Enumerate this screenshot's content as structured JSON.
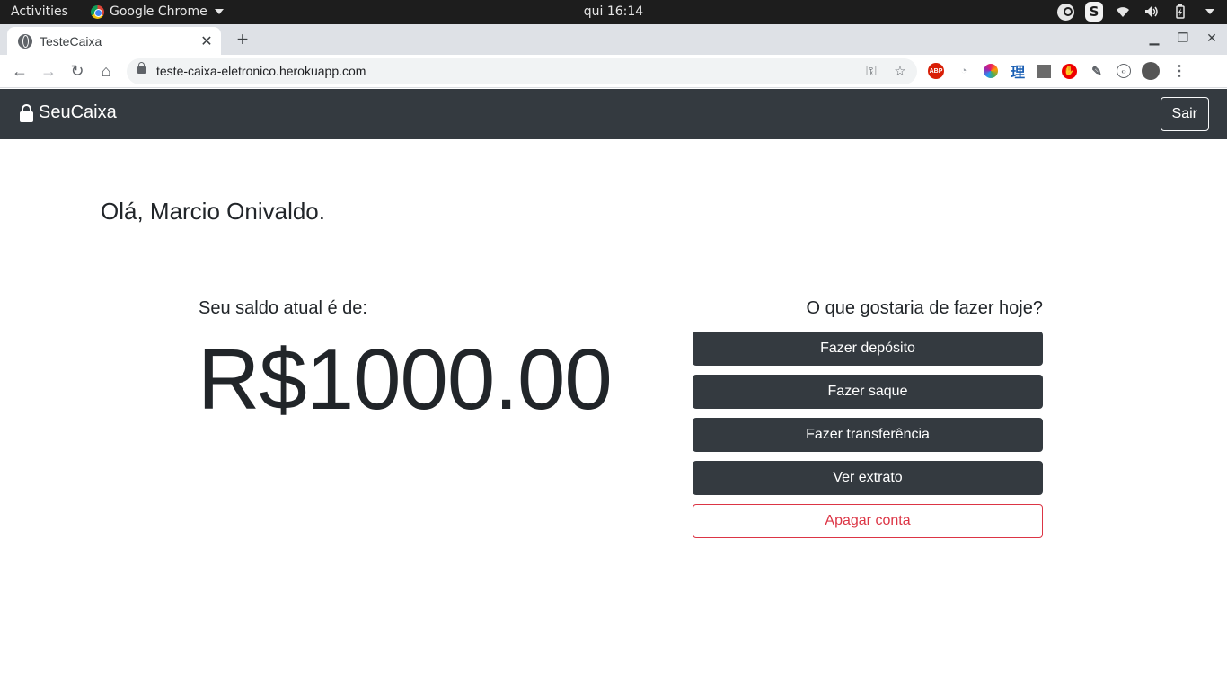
{
  "system_bar": {
    "activities": "Activities",
    "app_name": "Google Chrome",
    "clock": "qui 16:14"
  },
  "browser": {
    "tab_title": "TesteCaixa",
    "url": "teste-caixa-eletronico.herokuapp.com"
  },
  "app": {
    "brand": "SeuCaixa",
    "logout_label": "Sair",
    "greeting": "Olá, Marcio Onivaldo.",
    "balance_label": "Seu saldo atual é de:",
    "balance_value": "R$1000.00",
    "actions_title": "O que gostaria de fazer hoje?",
    "actions": {
      "deposit": "Fazer depósito",
      "withdraw": "Fazer saque",
      "transfer": "Fazer transferência",
      "statement": "Ver extrato",
      "delete_account": "Apagar conta"
    }
  },
  "colors": {
    "navbar": "#343a40",
    "danger": "#dc3545"
  }
}
